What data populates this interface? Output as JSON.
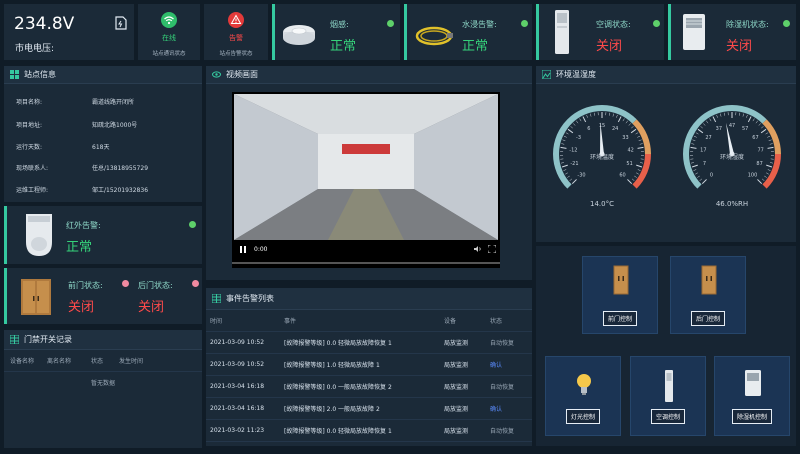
{
  "top": {
    "voltage": {
      "value": "234.8V",
      "label": "市电电压:"
    },
    "comm": {
      "status": "在线",
      "label": "站点通讯状态"
    },
    "alarm": {
      "status": "告警",
      "label": "站点告警状态"
    },
    "smoke": {
      "label": "烟感:",
      "value": "正常"
    },
    "water": {
      "label": "水浸告警:",
      "value": "正常"
    },
    "ac": {
      "label": "空调状态:",
      "value": "关闭"
    },
    "dehum": {
      "label": "除湿机状态:",
      "value": "关闭"
    }
  },
  "site": {
    "title": "站点信息",
    "rows": [
      {
        "k": "项目名称:",
        "v": "霸道线路开闭所"
      },
      {
        "k": "项目地址:",
        "v": "知疏北路1000号"
      },
      {
        "k": "运行天数:",
        "v": "618天"
      },
      {
        "k": "现场联系人:",
        "v": "任总/13818955729"
      },
      {
        "k": "运维工程师:",
        "v": "邹工/15201932836"
      }
    ]
  },
  "infrared": {
    "label": "红外告警:",
    "value": "正常"
  },
  "doors": {
    "front_label": "前门状态:",
    "front_value": "关闭",
    "back_label": "后门状态:",
    "back_value": "关闭"
  },
  "access_log": {
    "title": "门禁开关记录",
    "columns": [
      "设备名称",
      "离名名称",
      "状态",
      "发生时间"
    ],
    "empty": "暂无数据"
  },
  "video": {
    "title": "视频画面",
    "time": "0:00"
  },
  "events": {
    "title": "事件告警列表",
    "columns": [
      "时间",
      "事件",
      "设备",
      "状态"
    ],
    "rows": [
      {
        "time": "2021-03-09 10:52",
        "event": "[故障报警等级] 0.0 轻微局放故障恢复 1",
        "device": "局放监测",
        "status": "自动恢复",
        "kind": "auto"
      },
      {
        "time": "2021-03-09 10:52",
        "event": "[故障报警等级] 1.0 轻微局放故障 1",
        "device": "局放监测",
        "status": "确认",
        "kind": "confirm"
      },
      {
        "time": "2021-03-04 16:18",
        "event": "[故障报警等级] 0.0 一般局放故障恢复 2",
        "device": "局放监测",
        "status": "自动恢复",
        "kind": "auto"
      },
      {
        "time": "2021-03-04 16:18",
        "event": "[故障报警等级] 2.0 一般局放故障 2",
        "device": "局放监测",
        "status": "确认",
        "kind": "confirm"
      },
      {
        "time": "2021-03-02 11:23",
        "event": "[故障报警等级] 0.0 轻微局放故障恢复 1",
        "device": "局放监测",
        "status": "自动恢复",
        "kind": "auto"
      }
    ]
  },
  "env": {
    "title": "环境温湿度",
    "temp": {
      "label": "环境温度",
      "value_text": "14.0°C",
      "value": 14,
      "min": -30,
      "max": 60,
      "ticks": [
        "-30",
        "-21",
        "-12",
        "-3",
        "6",
        "15",
        "24",
        "33",
        "42",
        "51",
        "60"
      ]
    },
    "hum": {
      "label": "环境湿度",
      "value_text": "46.0%RH",
      "value": 46,
      "min": 0,
      "max": 100,
      "ticks": [
        "0",
        "7",
        "17",
        "27",
        "37",
        "47",
        "57",
        "67",
        "77",
        "87",
        "100"
      ]
    }
  },
  "controls": {
    "front_door": "前门控制",
    "back_door": "后门控制",
    "light": "灯光控制",
    "ac": "空调控制",
    "dehum": "除湿机控制"
  },
  "colors": {
    "ok": "#35d27a",
    "alarm": "#ff4a4a",
    "gauge_cold": "#8ec3c8",
    "gauge_hot": "#e8604a"
  }
}
